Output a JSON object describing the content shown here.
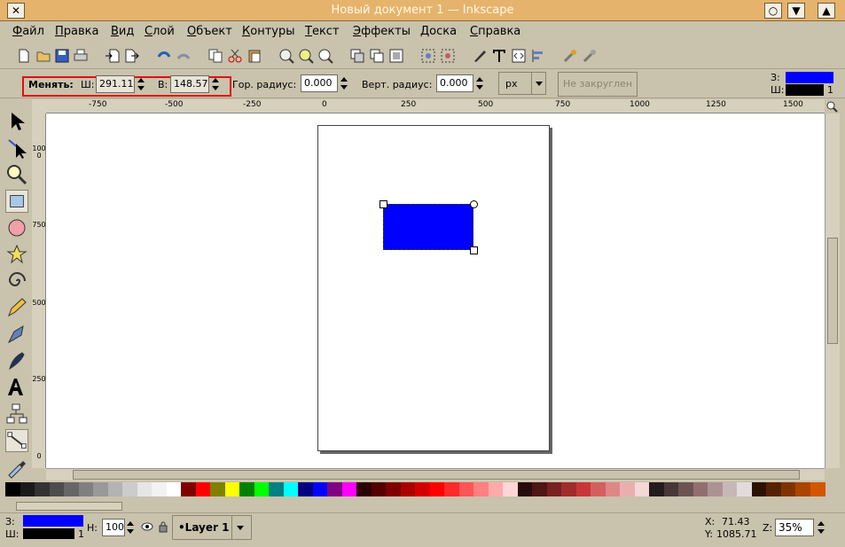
{
  "window": {
    "title": "Новый документ 1 — Inkscape",
    "close_glyph": "✕",
    "buttons": [
      "○",
      "▼",
      "▲"
    ]
  },
  "menu": [
    "Файл",
    "Правка",
    "Вид",
    "Слой",
    "Объект",
    "Контуры",
    "Текст",
    "Эффекты",
    "Доска",
    "Справка"
  ],
  "tool_controls": {
    "change_label": "Менять:",
    "w_label": "Ш:",
    "w_value": "291.11",
    "h_label": "В:",
    "h_value": "148.57",
    "rx_label": "Гор. радиус:",
    "rx_value": "0.000",
    "ry_label": "Верт. радиус:",
    "ry_value": "0.000",
    "unit": "px",
    "not_rounded_button": "Не закруглен",
    "fill_label": "З:",
    "stroke_label": "Ш:",
    "stroke_width": "1"
  },
  "ruler": {
    "h_ticks": [
      "-750",
      "-500",
      "-250",
      "0",
      "250",
      "500",
      "750",
      "1000",
      "1250",
      "1500"
    ],
    "v_ticks": [
      "1000",
      "750",
      "500",
      "250",
      "0"
    ]
  },
  "status": {
    "fill_label": "З:",
    "stroke_label": "Ш:",
    "stroke_width": "1",
    "opacity_label": "Н:",
    "opacity_value": "100",
    "layer": "•Layer 1",
    "x_label": "X:",
    "x_value": "71.43",
    "y_label": "Y:",
    "y_value": "1085.71",
    "zoom_label": "Z:",
    "zoom_value": "35%"
  },
  "colors": {
    "selected_fill": "#0000ff",
    "stroke": "#000000",
    "highlight": "#e01010"
  },
  "palette": [
    "#000000",
    "#1a1a1a",
    "#333333",
    "#4d4d4d",
    "#666666",
    "#808080",
    "#999999",
    "#b3b3b3",
    "#cccccc",
    "#e6e6e6",
    "#f2f2f2",
    "#ffffff",
    "#800000",
    "#ff0000",
    "#808000",
    "#ffff00",
    "#008000",
    "#00ff00",
    "#008080",
    "#00ffff",
    "#000080",
    "#0000ff",
    "#800080",
    "#ff00ff",
    "#2b0000",
    "#550000",
    "#800000",
    "#aa0000",
    "#d40000",
    "#ff0000",
    "#ff2a2a",
    "#ff5555",
    "#ff8080",
    "#ffaaaa",
    "#ffd5d5",
    "#280b0b",
    "#501616",
    "#782121",
    "#a02c2c",
    "#c83737",
    "#d35f5f",
    "#de8787",
    "#e9afaf",
    "#f4d7d7",
    "#241c1c",
    "#483737",
    "#6c5353",
    "#916f6f",
    "#ac9393",
    "#c8b7b7",
    "#e3dbdb",
    "#2b1100",
    "#552200",
    "#803300",
    "#aa4400",
    "#d45500"
  ]
}
